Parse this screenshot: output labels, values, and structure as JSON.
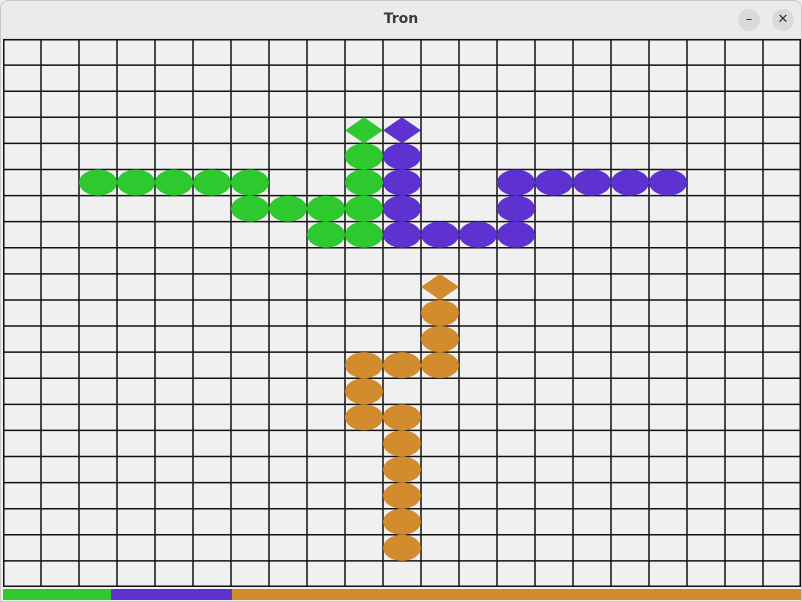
{
  "window": {
    "title": "Tron",
    "minimize_glyph": "–",
    "close_glyph": "✕"
  },
  "grid": {
    "cols": 21,
    "rows": 21
  },
  "players": [
    {
      "name": "green",
      "color": "#2ec92e",
      "head": [
        9,
        3
      ],
      "trail": [
        [
          2,
          5
        ],
        [
          3,
          5
        ],
        [
          4,
          5
        ],
        [
          5,
          5
        ],
        [
          6,
          5
        ],
        [
          6,
          6
        ],
        [
          7,
          6
        ],
        [
          8,
          6
        ],
        [
          8,
          7
        ],
        [
          9,
          7
        ],
        [
          9,
          6
        ],
        [
          9,
          5
        ],
        [
          9,
          4
        ]
      ],
      "score_share": 0.135
    },
    {
      "name": "purple",
      "color": "#5d32d0",
      "head": [
        10,
        3
      ],
      "trail": [
        [
          10,
          4
        ],
        [
          10,
          5
        ],
        [
          10,
          6
        ],
        [
          10,
          7
        ],
        [
          11,
          7
        ],
        [
          12,
          7
        ],
        [
          13,
          7
        ],
        [
          13,
          6
        ],
        [
          13,
          5
        ],
        [
          14,
          5
        ],
        [
          15,
          5
        ],
        [
          16,
          5
        ],
        [
          17,
          5
        ]
      ],
      "score_share": 0.152
    },
    {
      "name": "orange",
      "color": "#d28c2e",
      "head": [
        11,
        9
      ],
      "trail": [
        [
          11,
          10
        ],
        [
          11,
          11
        ],
        [
          11,
          12
        ],
        [
          10,
          12
        ],
        [
          9,
          12
        ],
        [
          9,
          13
        ],
        [
          9,
          14
        ],
        [
          10,
          14
        ],
        [
          10,
          15
        ],
        [
          10,
          16
        ],
        [
          10,
          17
        ],
        [
          10,
          18
        ],
        [
          10,
          19
        ]
      ],
      "score_share": 0.713
    }
  ]
}
